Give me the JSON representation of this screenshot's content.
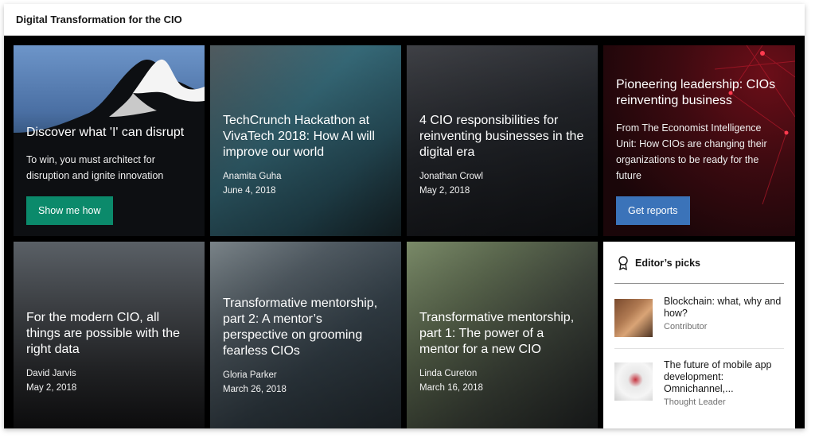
{
  "header": {
    "title": "Digital Transformation for the CIO"
  },
  "tiles": [
    {
      "title": "Discover what 'I' can disrupt",
      "description": "To win, you must architect for disruption and ignite innovation",
      "button": "Show me how"
    },
    {
      "title": "TechCrunch Hackathon at VivaTech 2018: How AI will improve our world",
      "author": "Anamita Guha",
      "date": "June 4, 2018"
    },
    {
      "title": "4 CIO responsibilities for reinventing businesses in the digital era",
      "author": "Jonathan Crowl",
      "date": "May 2, 2018"
    },
    {
      "title": "Pioneering leadership: CIOs reinventing business",
      "description": "From The Economist Intelligence Unit: How CIOs are changing their organizations to be ready for the future",
      "button": "Get reports"
    },
    {
      "title": "For the modern CIO, all things are possible with the right data",
      "author": "David Jarvis",
      "date": "May 2, 2018"
    },
    {
      "title": "Transformative mentorship, part 2: A mentor’s perspective on grooming fearless CIOs",
      "author": "Gloria Parker",
      "date": "March 26, 2018"
    },
    {
      "title": "Transformative mentorship, part 1: The power of a mentor for a new CIO",
      "author": "Linda Cureton",
      "date": "March 16, 2018"
    }
  ],
  "editors_picks": {
    "title": "Editor’s picks",
    "icon": "award-ribbon-icon",
    "items": [
      {
        "title": "Blockchain: what, why and how?",
        "tag": "Contributor"
      },
      {
        "title": "The future of mobile app development: Omnichannel,...",
        "tag": "Thought Leader"
      }
    ]
  },
  "colors": {
    "teal_button": "#0b8a6b",
    "blue_button": "#3b73b9"
  }
}
